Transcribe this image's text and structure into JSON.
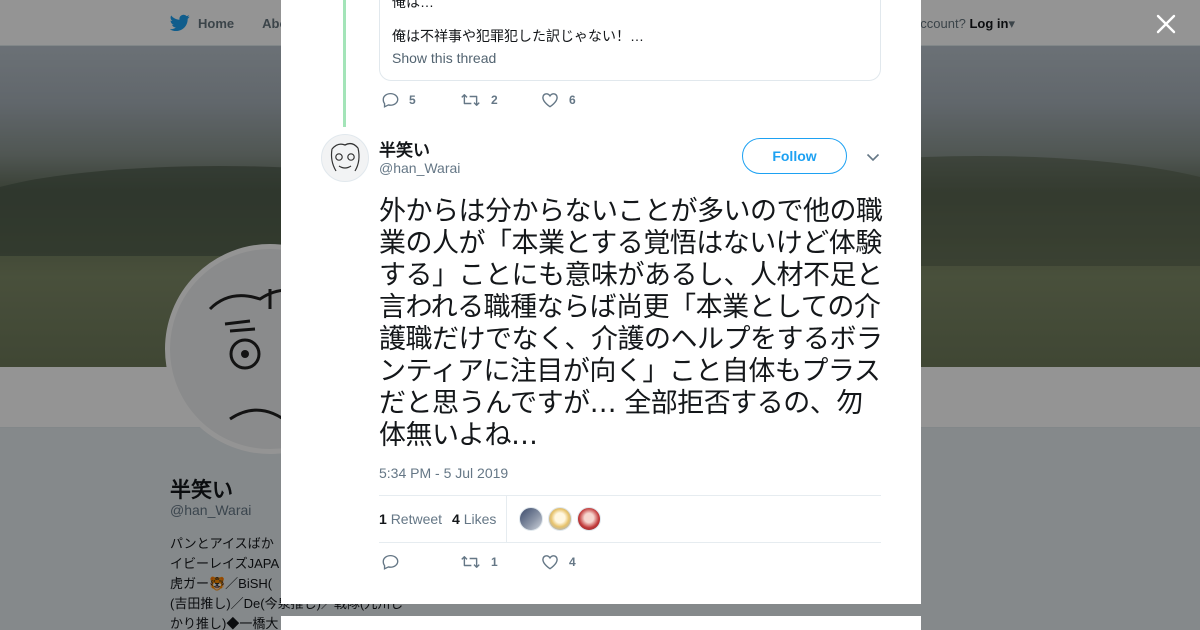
{
  "background": {
    "nav": {
      "home": "Home",
      "about": "Abo"
    },
    "login": {
      "prefix": "account?",
      "link": "Log in"
    },
    "profile_name": "半笑い",
    "profile_handle": "@han_Warai",
    "bio_lines": [
      "パンとアイスばか",
      "イビーレイズJAPA",
      "虎ガー🐯／BiSH(",
      "(吉田推し)／De(今泉推し)／戦隊(九州じ",
      "かり推し)◆一橋大"
    ]
  },
  "quoted": {
    "cut_line": "俺は…",
    "text": "俺は不祥事や犯罪犯した訳じゃない！…",
    "show_thread": "Show this thread"
  },
  "prev_actions": {
    "replies": "5",
    "retweets": "2",
    "likes": "6"
  },
  "tweet": {
    "name": "半笑い",
    "handle": "@han_Warai",
    "follow_label": "Follow",
    "text": "外からは分からないことが多いので他の職業の人が「本業とする覚悟はないけど体験する」ことにも意味があるし、人材不足と言われる職種ならば尚更「本業としての介護職だけでなく、介護のヘルプをするボランティアに注目が向く」こと自体もプラスだと思うんですが… 全部拒否するの、勿体無いよね…",
    "timestamp": "5:34 PM - 5 Jul 2019",
    "retweet_count": "1",
    "retweet_label": "Retweet",
    "like_count": "4",
    "like_label": "Likes",
    "likers": [
      "liker-avatar-1",
      "liker-avatar-2",
      "liker-avatar-3"
    ]
  },
  "actions": {
    "replies": "",
    "retweets": "1",
    "likes": "4"
  },
  "colors": {
    "accent": "#1da1f2",
    "thread": "#a3e4b8",
    "muted": "#657786",
    "text": "#14171a"
  }
}
